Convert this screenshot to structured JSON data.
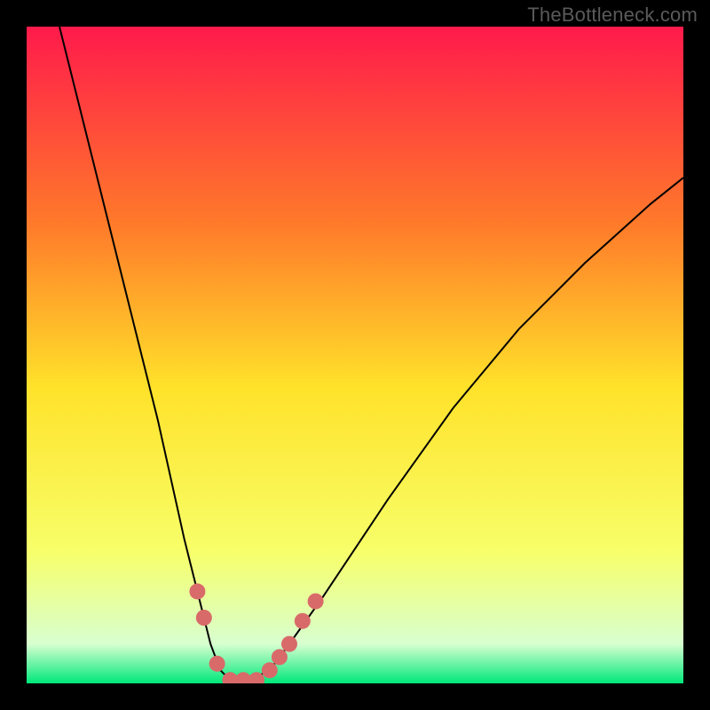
{
  "watermark": "TheBottleneck.com",
  "chart_data": {
    "type": "line",
    "title": "",
    "xlabel": "",
    "ylabel": "",
    "xlim": [
      0,
      100
    ],
    "ylim": [
      0,
      100
    ],
    "grid": false,
    "background_gradient": {
      "top": "#ff1a4b",
      "upper_mid": "#ff7a2a",
      "mid": "#ffe22a",
      "lower_mid": "#f7ff6a",
      "bottom_band": "#d8ffd0",
      "bottom": "#00e87a"
    },
    "series": [
      {
        "name": "bottleneck-score-curve",
        "color": "#000000",
        "stroke_width": 2,
        "x": [
          5,
          10,
          15,
          20,
          24,
          26,
          28,
          29.5,
          31,
          34,
          37,
          40,
          45,
          55,
          65,
          75,
          85,
          95,
          100
        ],
        "values": [
          100,
          80,
          60,
          40,
          22,
          14,
          6,
          2,
          0.5,
          0.5,
          2,
          6,
          13,
          28,
          42,
          54,
          64,
          73,
          77
        ]
      }
    ],
    "highlight_markers": {
      "name": "highlighted-range",
      "color": "#d96a6a",
      "radius": 9,
      "points": [
        {
          "x": 26,
          "y": 14
        },
        {
          "x": 27,
          "y": 10
        },
        {
          "x": 29,
          "y": 3
        },
        {
          "x": 31,
          "y": 0.5
        },
        {
          "x": 33,
          "y": 0.5
        },
        {
          "x": 35,
          "y": 0.5
        },
        {
          "x": 37,
          "y": 2
        },
        {
          "x": 38.5,
          "y": 4
        },
        {
          "x": 40,
          "y": 6
        },
        {
          "x": 42,
          "y": 9.5
        },
        {
          "x": 44,
          "y": 12.5
        }
      ]
    }
  }
}
